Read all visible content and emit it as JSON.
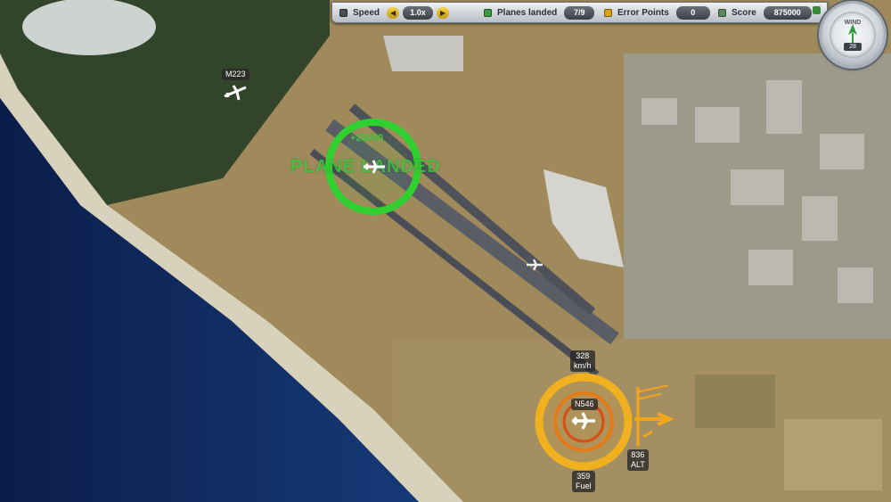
{
  "hud": {
    "speed_label": "Speed",
    "speed_value": "1.0x",
    "planes_landed_label": "Planes landed",
    "planes_landed_value": "7/9",
    "error_points_label": "Error Points",
    "error_points_value": "0",
    "score_label": "Score",
    "score_value": "875000"
  },
  "wind_gauge": {
    "label": "WIND",
    "value": "28"
  },
  "planes": [
    {
      "callsign": "M223"
    },
    {
      "callsign": "N546",
      "speed": "328",
      "speed_unit": "km/h",
      "altitude": "836",
      "altitude_unit": "ALT",
      "fuel": "359",
      "fuel_label": "Fuel"
    }
  ],
  "landing_event": {
    "message": "PLANE LANDED",
    "points": "+25000"
  },
  "colors": {
    "landed_ring": "#2fd02f",
    "selected_ring": "#f0b020",
    "hud_accent": "#f4d64a"
  }
}
